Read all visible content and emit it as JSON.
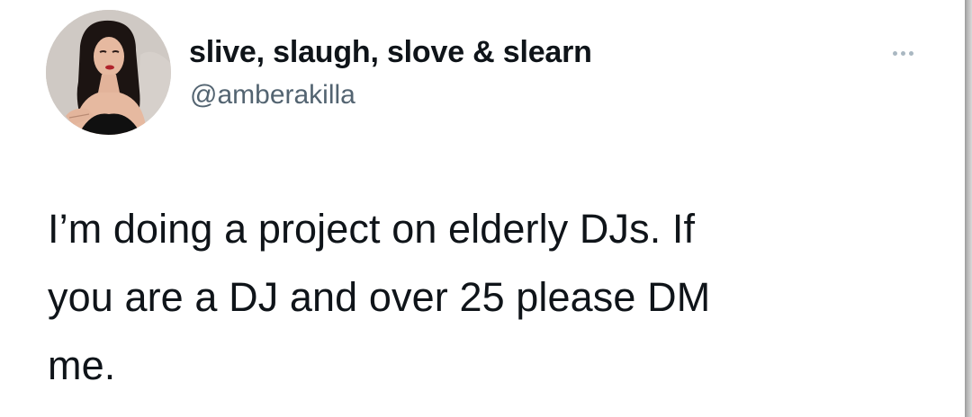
{
  "tweet": {
    "display_name": "slive, slaugh, slove & slearn",
    "handle": "@amberakilla",
    "text": "I’m doing a project on elderly DJs. If\nyou are a DJ and over 25 please DM\nme.",
    "avatar_icon": "profile-photo",
    "more_icon": "more-options-icon"
  },
  "colors": {
    "text_primary": "#0f1419",
    "text_secondary": "#536471",
    "more_dots": "#aab8c2",
    "background": "#ffffff"
  }
}
